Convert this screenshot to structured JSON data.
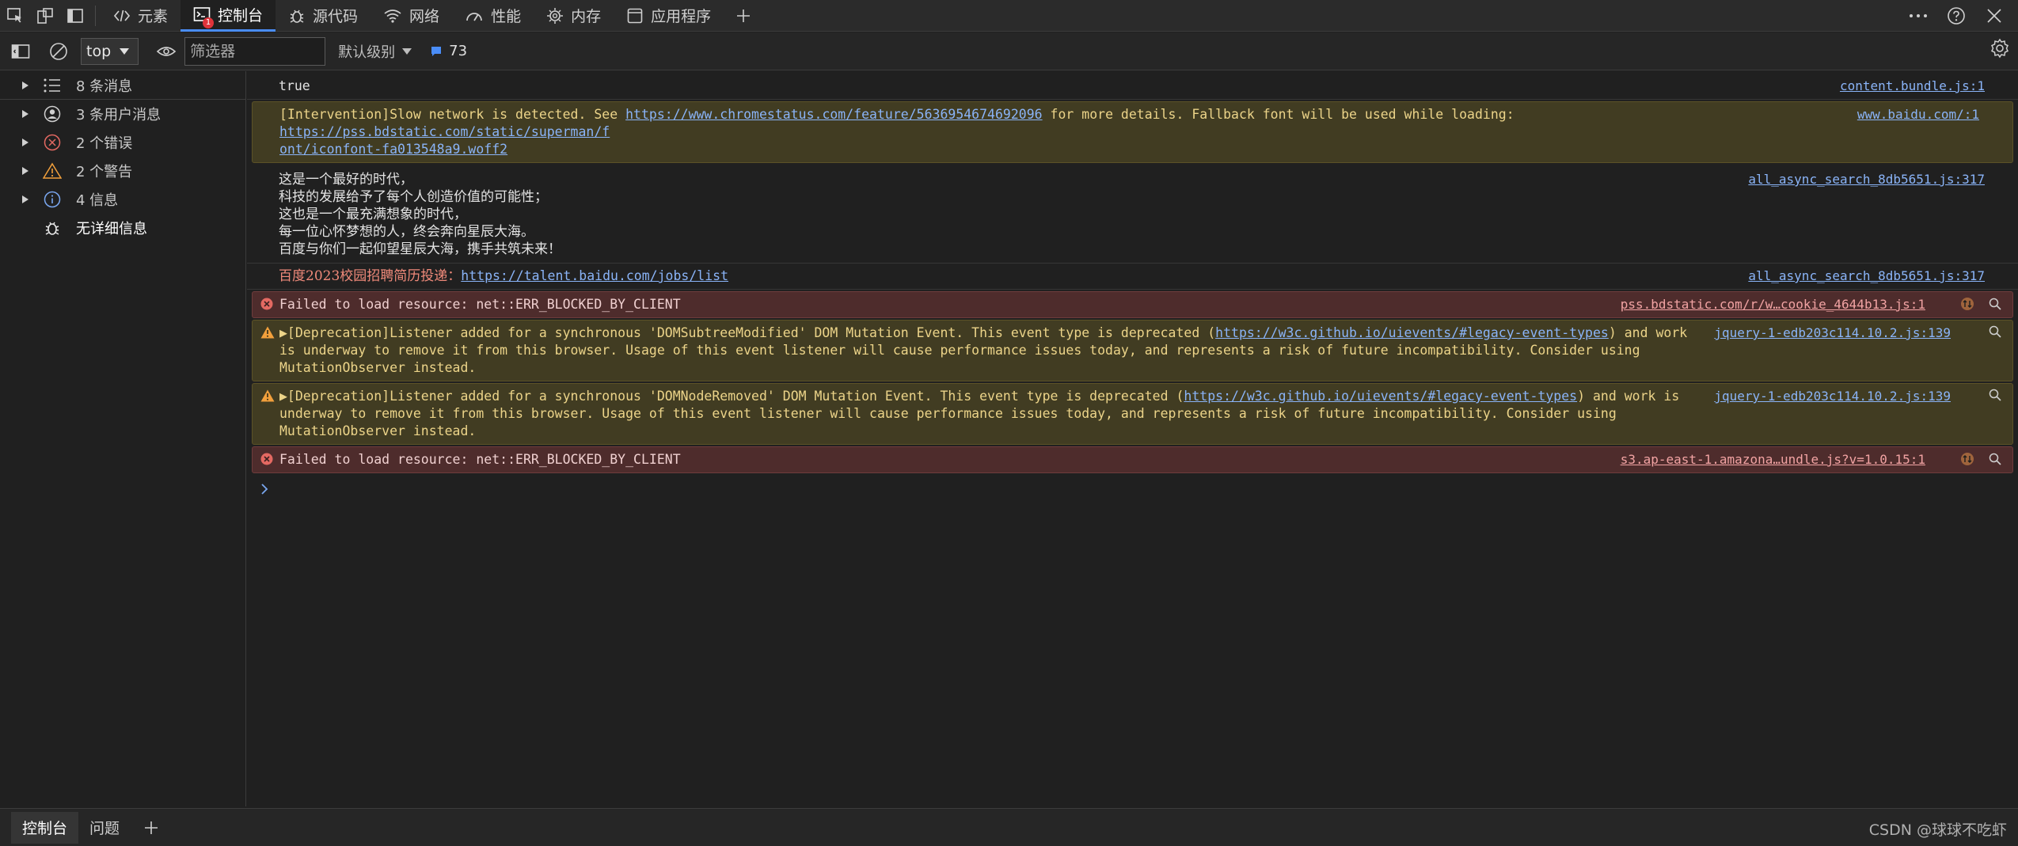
{
  "tabs": [
    {
      "label": "元素",
      "icon": "code-icon"
    },
    {
      "label": "控制台",
      "icon": "console-icon",
      "badge": "1"
    },
    {
      "label": "源代码",
      "icon": "bug-icon"
    },
    {
      "label": "网络",
      "icon": "wifi-icon"
    },
    {
      "label": "性能",
      "icon": "gauge-icon"
    },
    {
      "label": "内存",
      "icon": "chip-icon"
    },
    {
      "label": "应用程序",
      "icon": "window-icon"
    }
  ],
  "toolbar": {
    "context": "top",
    "filter_placeholder": "筛选器",
    "level": "默认级别",
    "issue_count": "73"
  },
  "sidebar": {
    "items": [
      {
        "label": "8 条消息",
        "icon": "list-icon"
      },
      {
        "label": "3 条用户消息",
        "icon": "user-icon"
      },
      {
        "label": "2 个错误",
        "icon": "error-icon"
      },
      {
        "label": "2 个警告",
        "icon": "warning-icon"
      },
      {
        "label": "4 信息",
        "icon": "info-icon"
      },
      {
        "label": "无详细信息",
        "icon": "bug-icon"
      }
    ]
  },
  "console": {
    "m1": {
      "text": "true",
      "source": "content.bundle.js:1"
    },
    "m2": {
      "text_a": "[Intervention]Slow network is detected. See ",
      "link_a": "https://www.chromestatus.com/feature/5636954674692096",
      "text_b": " for more details. Fallback font will be used while loading: ",
      "link_b": "https://pss.bdstatic.com/static/superman/f",
      "link_b2": "ont/iconfont-fa013548a9.woff2",
      "source": "www.baidu.com/:1"
    },
    "m3": {
      "lines": [
        "这是一个最好的时代，",
        "科技的发展给予了每个人创造价值的可能性；",
        "这也是一个最充满想象的时代，",
        "每一位心怀梦想的人，终会奔向星辰大海。",
        "百度与你们一起仰望星辰大海，携手共筑未来！"
      ],
      "source": "all_async_search_8db5651.js:317"
    },
    "m4": {
      "text": "百度2023校园招聘简历投递：",
      "link": "https://talent.baidu.com/jobs/list",
      "source": "all_async_search_8db5651.js:317"
    },
    "m5": {
      "text": "Failed to load resource: net::ERR_BLOCKED_BY_CLIENT",
      "source": "pss.bdstatic.com/r/w…cookie_4644b13.js:1"
    },
    "m6": {
      "text_a": "▶[Deprecation]Listener added for a synchronous 'DOMSubtreeModified' DOM Mutation Event. This event type is deprecated (",
      "link": "https://w3c.github.io/uievents/#legacy-event-types",
      "text_b": ") and work is underway to remove it from this browser. Usage of this event listener will cause performance issues today, and represents a risk of future incompatibility. Consider using MutationObserver instead.",
      "source": "jquery-1-edb203c114.10.2.js:139"
    },
    "m7": {
      "text_a": "▶[Deprecation]Listener added for a synchronous 'DOMNodeRemoved' DOM Mutation Event. This event type is deprecated (",
      "link": "https://w3c.github.io/uievents/#legacy-event-types",
      "text_b": ") and work is underway to remove it from this browser. Usage of this event listener will cause performance issues today, and represents a risk of future incompatibility. Consider using MutationObserver instead.",
      "source": "jquery-1-edb203c114.10.2.js:139"
    },
    "m8": {
      "text": "Failed to load resource: net::ERR_BLOCKED_BY_CLIENT",
      "source": "s3.ap-east-1.amazona…undle.js?v=1.0.15:1"
    }
  },
  "drawer": {
    "tabs": [
      "控制台",
      "问题"
    ]
  },
  "watermark": "CSDN @球球不吃虾",
  "colors": {
    "accent": "#4a8df8",
    "error_bg": "#4e2c2c",
    "warning_bg": "#413c22",
    "link": "#8ab4f8"
  }
}
